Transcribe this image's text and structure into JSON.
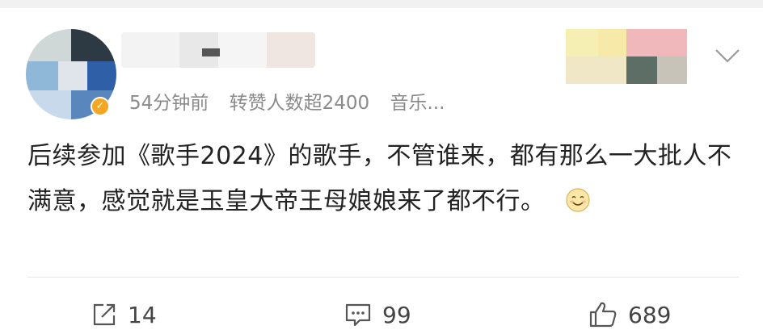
{
  "post": {
    "meta": {
      "time": "54分钟前",
      "repost_info": "转赞人数超2400",
      "source": "音乐..."
    },
    "text": "后续参加《歌手2024》的歌手，不管谁来，都有那么一大批人不满意，感觉就是玉皇大帝王母娘娘来了都不行。",
    "emoji": "smile"
  },
  "actions": {
    "repost_count": "14",
    "comment_count": "99",
    "like_count": "689"
  },
  "icons": [
    "chevron-down-icon",
    "repost-icon",
    "comment-icon",
    "like-icon",
    "smile-emoji"
  ]
}
